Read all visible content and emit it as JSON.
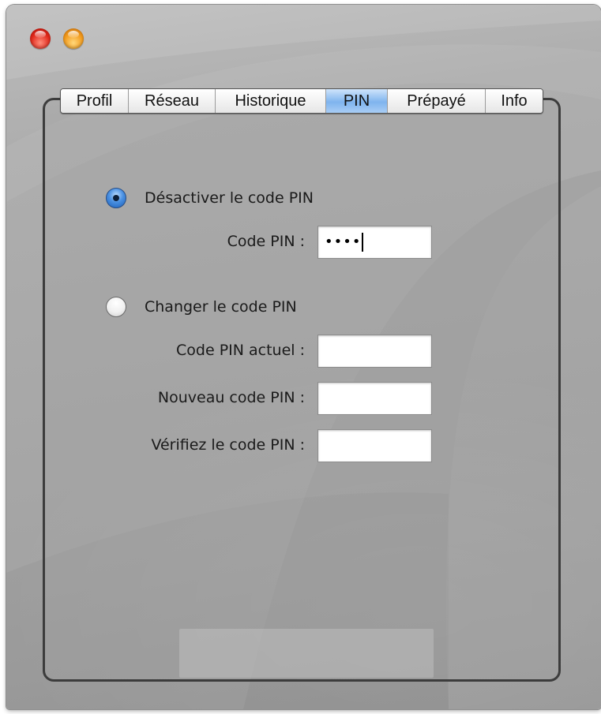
{
  "window": {
    "traffic_lights": [
      {
        "name": "close",
        "color": "#e0281b"
      },
      {
        "name": "minimize",
        "color": "#f29a1c"
      }
    ]
  },
  "tabs": [
    {
      "label": "Profil",
      "active": false
    },
    {
      "label": "Réseau",
      "active": false
    },
    {
      "label": "Historique",
      "active": false
    },
    {
      "label": "PIN",
      "active": true
    },
    {
      "label": "Prépayé",
      "active": false
    },
    {
      "label": "Info",
      "active": false
    }
  ],
  "pin_panel": {
    "disable_option": {
      "label": "Désactiver le code PIN",
      "selected": true,
      "field_label": "Code PIN :",
      "field_value_masked": "••••"
    },
    "change_option": {
      "label": "Changer le code PIN",
      "selected": false,
      "current_label": "Code PIN actuel :",
      "new_label": "Nouveau code PIN :",
      "verify_label": "Vérifiez le code PIN :"
    }
  },
  "colors": {
    "active_tab": "#7fb4ee",
    "radio_selected": "#4a90e2"
  }
}
